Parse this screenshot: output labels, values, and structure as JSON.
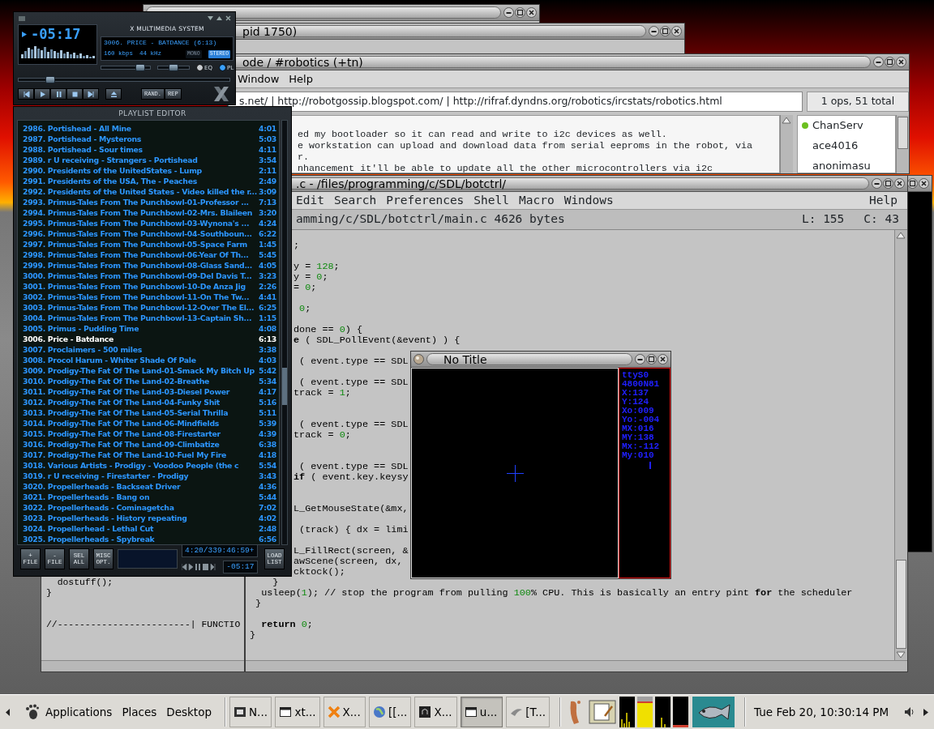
{
  "back_windows": [
    {
      "kind": "untitled"
    },
    {
      "kind": "titled",
      "title": "pid 1750)"
    }
  ],
  "irc": {
    "title": "ode / #robotics (+tn)",
    "menu": [
      "Window",
      "Help"
    ],
    "topic": "s.net/ | http://robotgossip.blogspot.com/ | http://rifraf.dyndns.org/robotics/ircstats/robotics.html",
    "ops_summary": "1 ops, 51 total",
    "messages": [
      "ed my bootloader so it can read and write to i2c devices as well.",
      "e workstation can upload and download data from serial eeproms in the robot, via",
      "r.",
      "nhancement it'll be able to update all the other microcontrollers via i2c"
    ],
    "users": [
      {
        "name": "ChanServ",
        "op": true
      },
      {
        "name": "ace4016",
        "op": false
      },
      {
        "name": "anonimasu",
        "op": false
      }
    ]
  },
  "side_code": [
    {
      "kind": "code",
      "parts": [
        {
          "kind": "plain",
          "text": "  dostuff();"
        }
      ]
    },
    {
      "kind": "code",
      "parts": [
        {
          "kind": "plain",
          "text": "}"
        }
      ]
    },
    {
      "kind": "blank"
    },
    {
      "kind": "blank"
    },
    {
      "kind": "code",
      "parts": [
        {
          "kind": "plain",
          "text": "//------------------------| FUNCTIO"
        }
      ]
    }
  ],
  "editor": {
    "title": ".c - /files/programming/c/SDL/botctrl/",
    "menu": [
      "Edit",
      "Search",
      "Preferences",
      "Shell",
      "Macro",
      "Windows",
      "Help"
    ],
    "path": "amming/c/SDL/botctrl/main.c 4626 bytes",
    "line_indicator": "L: 155",
    "column_indicator": "C: 43",
    "code": [
      {
        "kind": "blank"
      },
      {
        "kind": "cut",
        "parts": [
          {
            "kind": "plain",
            "text": ";"
          }
        ]
      },
      {
        "kind": "blank"
      },
      {
        "kind": "cut",
        "parts": [
          {
            "kind": "plain",
            "text": "y = "
          },
          {
            "kind": "number",
            "text": "128"
          },
          {
            "kind": "plain",
            "text": ";"
          }
        ]
      },
      {
        "kind": "cut",
        "parts": [
          {
            "kind": "plain",
            "text": "y = "
          },
          {
            "kind": "number",
            "text": "0"
          },
          {
            "kind": "plain",
            "text": ";"
          }
        ]
      },
      {
        "kind": "cut",
        "parts": [
          {
            "kind": "plain",
            "text": "= "
          },
          {
            "kind": "number",
            "text": "0"
          },
          {
            "kind": "plain",
            "text": ";"
          }
        ]
      },
      {
        "kind": "blank"
      },
      {
        "kind": "cut",
        "parts": [
          {
            "kind": "number",
            "text": " 0"
          },
          {
            "kind": "plain",
            "text": ";"
          }
        ]
      },
      {
        "kind": "blank"
      },
      {
        "kind": "cut",
        "parts": [
          {
            "kind": "plain",
            "text": "done == "
          },
          {
            "kind": "number",
            "text": "0"
          },
          {
            "kind": "plain",
            "text": ") {"
          }
        ]
      },
      {
        "kind": "cut",
        "parts": [
          {
            "kind": "keyword",
            "text": "e"
          },
          {
            "kind": "plain",
            "text": " ( SDL_PollEvent(&event) ) {"
          }
        ]
      },
      {
        "kind": "blank"
      },
      {
        "kind": "cut",
        "parts": [
          {
            "kind": "plain",
            "text": " ( event.type == SDL"
          }
        ]
      },
      {
        "kind": "blank"
      },
      {
        "kind": "cut",
        "parts": [
          {
            "kind": "plain",
            "text": " ( event.type == SDL"
          }
        ]
      },
      {
        "kind": "cut",
        "parts": [
          {
            "kind": "plain",
            "text": "track = "
          },
          {
            "kind": "number",
            "text": "1"
          },
          {
            "kind": "plain",
            "text": ";"
          }
        ]
      },
      {
        "kind": "blank"
      },
      {
        "kind": "blank"
      },
      {
        "kind": "cut",
        "parts": [
          {
            "kind": "plain",
            "text": " ( event.type == SDL"
          }
        ]
      },
      {
        "kind": "cut",
        "parts": [
          {
            "kind": "plain",
            "text": "track = "
          },
          {
            "kind": "number",
            "text": "0"
          },
          {
            "kind": "plain",
            "text": ";"
          }
        ]
      },
      {
        "kind": "blank"
      },
      {
        "kind": "blank"
      },
      {
        "kind": "cut",
        "parts": [
          {
            "kind": "plain",
            "text": " ( event.type == SDL"
          }
        ]
      },
      {
        "kind": "cut",
        "parts": [
          {
            "kind": "keyword",
            "text": "if"
          },
          {
            "kind": "plain",
            "text": " ( event.key.keysy"
          }
        ]
      },
      {
        "kind": "blank"
      },
      {
        "kind": "blank"
      },
      {
        "kind": "cut",
        "parts": [
          {
            "kind": "plain",
            "text": "L_GetMouseState(&mx,"
          }
        ]
      },
      {
        "kind": "blank"
      },
      {
        "kind": "cut",
        "parts": [
          {
            "kind": "plain",
            "text": " (track) { dx = limi"
          }
        ]
      },
      {
        "kind": "blank"
      },
      {
        "kind": "cut",
        "parts": [
          {
            "kind": "plain",
            "text": "L_FillRect(screen, &"
          }
        ]
      },
      {
        "kind": "cut",
        "parts": [
          {
            "kind": "plain",
            "text": "awScene(screen, dx,"
          }
        ]
      },
      {
        "kind": "cut",
        "parts": [
          {
            "kind": "plain",
            "text": "cktock();"
          }
        ]
      },
      {
        "kind": "code",
        "parts": [
          {
            "kind": "plain",
            "text": "    }"
          }
        ]
      },
      {
        "kind": "code",
        "parts": [
          {
            "kind": "plain",
            "text": "  usleep("
          },
          {
            "kind": "number",
            "text": "1"
          },
          {
            "kind": "plain",
            "text": "); // stop the program from pulling "
          },
          {
            "kind": "number",
            "text": "100"
          },
          {
            "kind": "plain",
            "text": "% CPU. This is basically an entry pint "
          },
          {
            "kind": "keyword",
            "text": "for"
          },
          {
            "kind": "plain",
            "text": " the scheduler"
          }
        ]
      },
      {
        "kind": "code",
        "parts": [
          {
            "kind": "plain",
            "text": " }"
          }
        ]
      },
      {
        "kind": "blank"
      },
      {
        "kind": "code",
        "parts": [
          {
            "kind": "keyword",
            "text": "  return"
          },
          {
            "kind": "number",
            "text": " 0"
          },
          {
            "kind": "plain",
            "text": ";"
          }
        ]
      },
      {
        "kind": "code",
        "parts": [
          {
            "kind": "plain",
            "text": "}"
          }
        ]
      }
    ]
  },
  "sdl_window": {
    "title": "No Title",
    "readout": [
      "ttyS0",
      "4800N81",
      "X:137",
      "Y:124",
      "Xo:009",
      "Yo:-004",
      "MX:016",
      "MY:138",
      "Mx:-112",
      "My:010"
    ]
  },
  "player": {
    "brand": "X MULTIMEDIA SYSTEM",
    "time": "-05:17",
    "song": "3006. PRICE - BATDANCE (6:13)",
    "bitrate": "160 kbps",
    "samplerate": "44 kHz",
    "channel_modes": [
      {
        "label": "MONO",
        "selected": false
      },
      {
        "label": "STEREO",
        "selected": true
      }
    ],
    "volume": {
      "level": 0.8
    },
    "balance": {
      "level": 0.5
    },
    "toggles": [
      {
        "label": "EQ",
        "on": false
      },
      {
        "label": "PL",
        "on": true
      }
    ],
    "seek": {
      "level": 0.15
    },
    "play_modes": [
      {
        "label": "RAND.",
        "on": false
      },
      {
        "label": "REP",
        "on": false
      }
    ]
  },
  "playlist": {
    "title": "PLAYLIST EDITOR",
    "tracks": [
      {
        "title": "2986. Portishead - All Mine",
        "time": "4:01",
        "selected": false
      },
      {
        "title": "2987. Portishead - Mysterons",
        "time": "5:03",
        "selected": false
      },
      {
        "title": "2988. Portishead - Sour times",
        "time": "4:11",
        "selected": false
      },
      {
        "title": "2989. r U receiving - Strangers - Portishead",
        "time": "3:54",
        "selected": false
      },
      {
        "title": "2990. Presidents of the UnitedStates - Lump",
        "time": "2:11",
        "selected": false
      },
      {
        "title": "2991. Presidents of the USA, The - Peaches",
        "time": "2:49",
        "selected": false
      },
      {
        "title": "2992. Presidents of the United States - Video killed the r...",
        "time": "3:09",
        "selected": false
      },
      {
        "title": "2993. Primus-Tales From The Punchbowl-01-Professor ...",
        "time": "7:13",
        "selected": false
      },
      {
        "title": "2994. Primus-Tales From The Punchbowl-02-Mrs. Blaileen",
        "time": "3:20",
        "selected": false
      },
      {
        "title": "2995. Primus-Tales From The Punchbowl-03-Wynona's ...",
        "time": "4:24",
        "selected": false
      },
      {
        "title": "2996. Primus-Tales From The Punchbowl-04-Southboun...",
        "time": "6:22",
        "selected": false
      },
      {
        "title": "2997. Primus-Tales From The Punchbowl-05-Space Farm",
        "time": "1:45",
        "selected": false
      },
      {
        "title": "2998. Primus-Tales From The Punchbowl-06-Year Of Th...",
        "time": "5:45",
        "selected": false
      },
      {
        "title": "2999. Primus-Tales From The Punchbowl-08-Glass Sand...",
        "time": "4:05",
        "selected": false
      },
      {
        "title": "3000. Primus-Tales From The Punchbowl-09-Del Davis T...",
        "time": "3:23",
        "selected": false
      },
      {
        "title": "3001. Primus-Tales From The Punchbowl-10-De Anza Jig",
        "time": "2:26",
        "selected": false
      },
      {
        "title": "3002. Primus-Tales From The Punchbowl-11-On The Tw...",
        "time": "4:41",
        "selected": false
      },
      {
        "title": "3003. Primus-Tales From The Punchbowl-12-Over The El...",
        "time": "6:25",
        "selected": false
      },
      {
        "title": "3004. Primus-Tales From The Punchbowl-13-Captain Sh...",
        "time": "1:15",
        "selected": false
      },
      {
        "title": "3005. Primus - Pudding Time",
        "time": "4:08",
        "selected": false
      },
      {
        "title": "3006. Price - Batdance",
        "time": "6:13",
        "selected": true
      },
      {
        "title": "3007. Proclaimers - 500 miles",
        "time": "3:38",
        "selected": false
      },
      {
        "title": "3008. Procol Harum - Whiter Shade Of Pale",
        "time": "4:03",
        "selected": false
      },
      {
        "title": "3009. Prodigy-The Fat Of The Land-01-Smack My Bitch Up",
        "time": "5:42",
        "selected": false
      },
      {
        "title": "3010. Prodigy-The Fat Of The Land-02-Breathe",
        "time": "5:34",
        "selected": false
      },
      {
        "title": "3011. Prodigy-The Fat Of The Land-03-Diesel Power",
        "time": "4:17",
        "selected": false
      },
      {
        "title": "3012. Prodigy-The Fat Of The Land-04-Funky Shit",
        "time": "5:16",
        "selected": false
      },
      {
        "title": "3013. Prodigy-The Fat Of The Land-05-Serial Thrilla",
        "time": "5:11",
        "selected": false
      },
      {
        "title": "3014. Prodigy-The Fat Of The Land-06-Mindfields",
        "time": "5:39",
        "selected": false
      },
      {
        "title": "3015. Prodigy-The Fat Of The Land-08-Firestarter",
        "time": "4:39",
        "selected": false
      },
      {
        "title": "3016. Prodigy-The Fat Of The Land-09-Climbatize",
        "time": "6:38",
        "selected": false
      },
      {
        "title": "3017. Prodigy-The Fat Of The Land-10-Fuel My Fire",
        "time": "4:18",
        "selected": false
      },
      {
        "title": "3018. Various Artists - Prodigy - Voodoo People (the c",
        "time": "5:54",
        "selected": false
      },
      {
        "title": "3019. r U receiving - Firestarter - Prodigy",
        "time": "3:43",
        "selected": false
      },
      {
        "title": "3020. Propellerheads - Backseat Driver",
        "time": "4:36",
        "selected": false
      },
      {
        "title": "3021. Propellerheads - Bang on",
        "time": "5:44",
        "selected": false
      },
      {
        "title": "3022. Propellerheads - Cominagetcha",
        "time": "7:02",
        "selected": false
      },
      {
        "title": "3023. Propellerheads - History repeating",
        "time": "4:02",
        "selected": false
      },
      {
        "title": "3024. Propellerhead - Lethal Cut",
        "time": "2:48",
        "selected": false
      },
      {
        "title": "3025. Propellerheads - Spybreak",
        "time": "6:56",
        "selected": false
      }
    ],
    "buttons": [
      "+ FILE",
      "- FILE",
      "SEL ALL",
      "MISC OPT."
    ],
    "total_time": "4:20/339:46:59+",
    "mini_time": "-05:17",
    "load_button": "LOAD LIST"
  },
  "taskbar": {
    "menus": [
      "Applications",
      "Places",
      "Desktop"
    ],
    "tasks": [
      {
        "kind": "media",
        "label": "N...",
        "selected": false
      },
      {
        "kind": "window",
        "label": "xt...",
        "selected": false
      },
      {
        "kind": "cross",
        "label": "X...",
        "selected": false
      },
      {
        "kind": "globe",
        "label": "[[...",
        "selected": false
      },
      {
        "kind": "terminal",
        "label": "X...",
        "selected": false
      },
      {
        "kind": "window",
        "label": "u...",
        "selected": true
      },
      {
        "kind": "swoosh",
        "label": "[T...",
        "selected": false
      }
    ],
    "clock": "Tue Feb 20, 10:30:14 PM"
  }
}
